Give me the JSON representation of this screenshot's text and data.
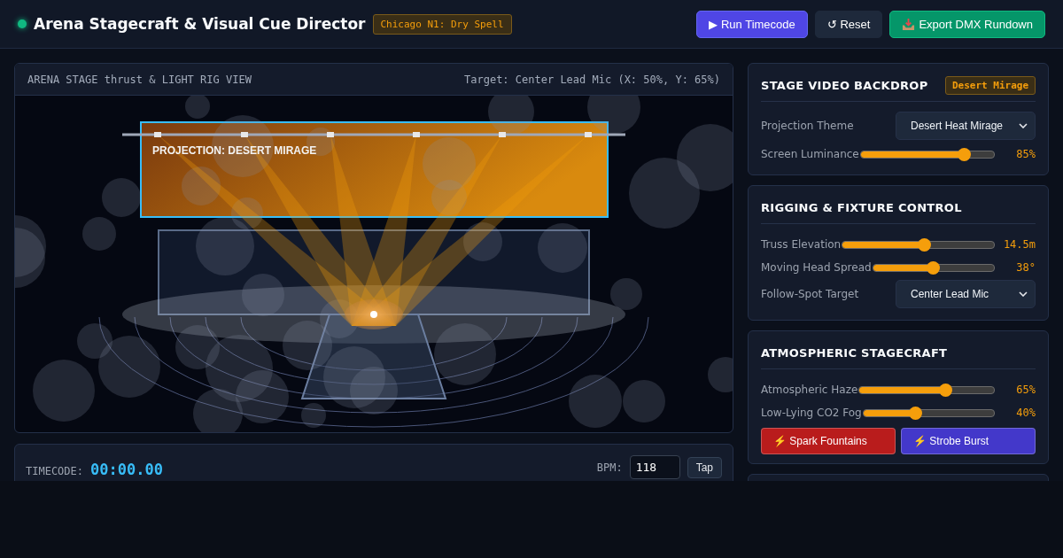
{
  "header": {
    "title": "Arena Stagecraft & Visual Cue Director",
    "venue_badge": "Chicago N1: Dry Spell",
    "buttons": [
      {
        "kind": "primary",
        "label": "▶ Run Timecode"
      },
      {
        "kind": "secondary",
        "label": "↺ Reset"
      },
      {
        "kind": "success",
        "label": "Export DMX Rundown"
      }
    ]
  },
  "stage_view": {
    "title": "ARENA STAGE thrust & LIGHT RIG VIEW",
    "target": "Target: Center Lead Mic (X: 50%, Y: 65%)",
    "screen_label": "PROJECTION: DESERT MIRAGE"
  },
  "timecode": {
    "label": "TIMECODE:",
    "value": "00:00.00",
    "bpm_label": "BPM:",
    "bpm_value": "118",
    "tap_label": "Tap"
  },
  "panels": [
    {
      "title": "STAGE VIDEO BACKDROP",
      "badge": "Desert Mirage",
      "controls": [
        {
          "kind": "select",
          "label": "Projection Theme",
          "value": "Desert Heat Mirage"
        },
        {
          "kind": "slider",
          "label": "Screen Luminance",
          "level": 0.78,
          "reading": "85%"
        }
      ]
    },
    {
      "title": "RIGGING & FIXTURE CONTROL",
      "controls": [
        {
          "kind": "slider",
          "label": "Truss Elevation",
          "level": 0.54,
          "reading": "14.5m"
        },
        {
          "kind": "slider",
          "label": "Moving Head Spread",
          "level": 0.5,
          "reading": "38°"
        },
        {
          "kind": "select",
          "label": "Follow-Spot Target",
          "value": "Center Lead Mic"
        }
      ]
    },
    {
      "title": "ATMOSPHERIC STAGECRAFT",
      "controls": [
        {
          "kind": "slider",
          "label": "Atmospheric Haze",
          "level": 0.64,
          "reading": "65%"
        },
        {
          "kind": "slider",
          "label": "Low-Lying CO2 Fog",
          "level": 0.4,
          "reading": "40%"
        }
      ],
      "actions": [
        {
          "icon": "⚡",
          "label": "Spark Fountains",
          "color": "#b91c1c"
        },
        {
          "icon": "⚡",
          "label": "Strobe Burst",
          "color": "#4338ca"
        }
      ]
    }
  ]
}
